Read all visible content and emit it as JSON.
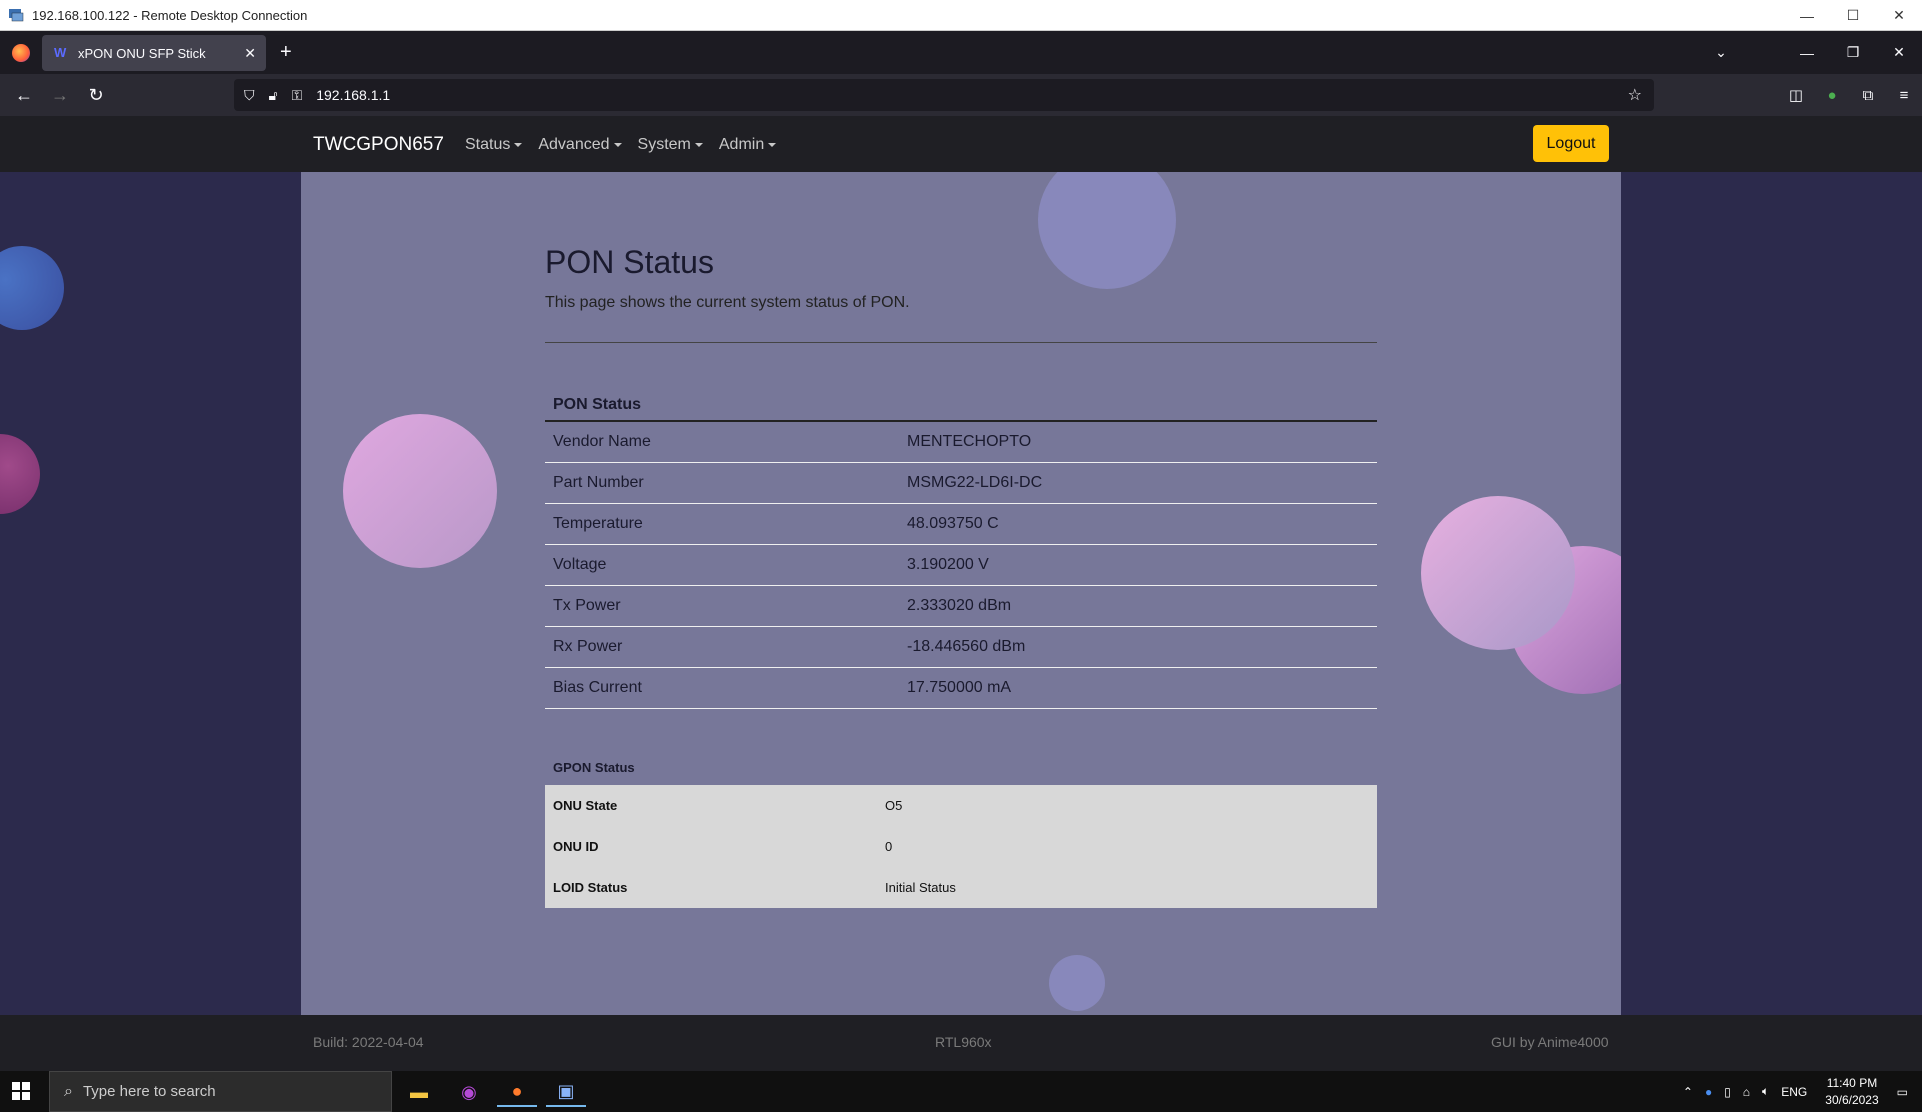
{
  "rdp": {
    "title": "192.168.100.122 - Remote Desktop Connection",
    "minimize": "—",
    "maximize": "☐",
    "close": "✕"
  },
  "browser": {
    "tab_title": "xPON ONU SFP Stick",
    "tab_close": "✕",
    "new_tab": "+",
    "url": "192.168.1.1"
  },
  "nav": {
    "brand": "TWCGPON657",
    "menu": [
      "Status",
      "Advanced",
      "System",
      "Admin"
    ],
    "logout": "Logout"
  },
  "page": {
    "title": "PON Status",
    "description": "This page shows the current system status of PON."
  },
  "pon_status": {
    "heading": "PON Status",
    "rows": [
      {
        "label": "Vendor Name",
        "value": "MENTECHOPTO"
      },
      {
        "label": "Part Number",
        "value": "MSMG22-LD6I-DC"
      },
      {
        "label": "Temperature",
        "value": "48.093750 C"
      },
      {
        "label": "Voltage",
        "value": "3.190200 V"
      },
      {
        "label": "Tx Power",
        "value": "2.333020 dBm"
      },
      {
        "label": "Rx Power",
        "value": "-18.446560 dBm"
      },
      {
        "label": "Bias Current",
        "value": "17.750000 mA"
      }
    ]
  },
  "gpon_status": {
    "heading": "GPON Status",
    "rows": [
      {
        "label": "ONU State",
        "value": "O5"
      },
      {
        "label": "ONU ID",
        "value": "0"
      },
      {
        "label": "LOID Status",
        "value": "Initial Status"
      }
    ]
  },
  "footer": {
    "build": "Build: 2022-04-04",
    "chip": "RTL960x",
    "credit": "GUI by Anime4000"
  },
  "taskbar": {
    "search_placeholder": "Type here to search",
    "language": "ENG",
    "time": "11:40 PM",
    "date": "30/6/2023"
  }
}
